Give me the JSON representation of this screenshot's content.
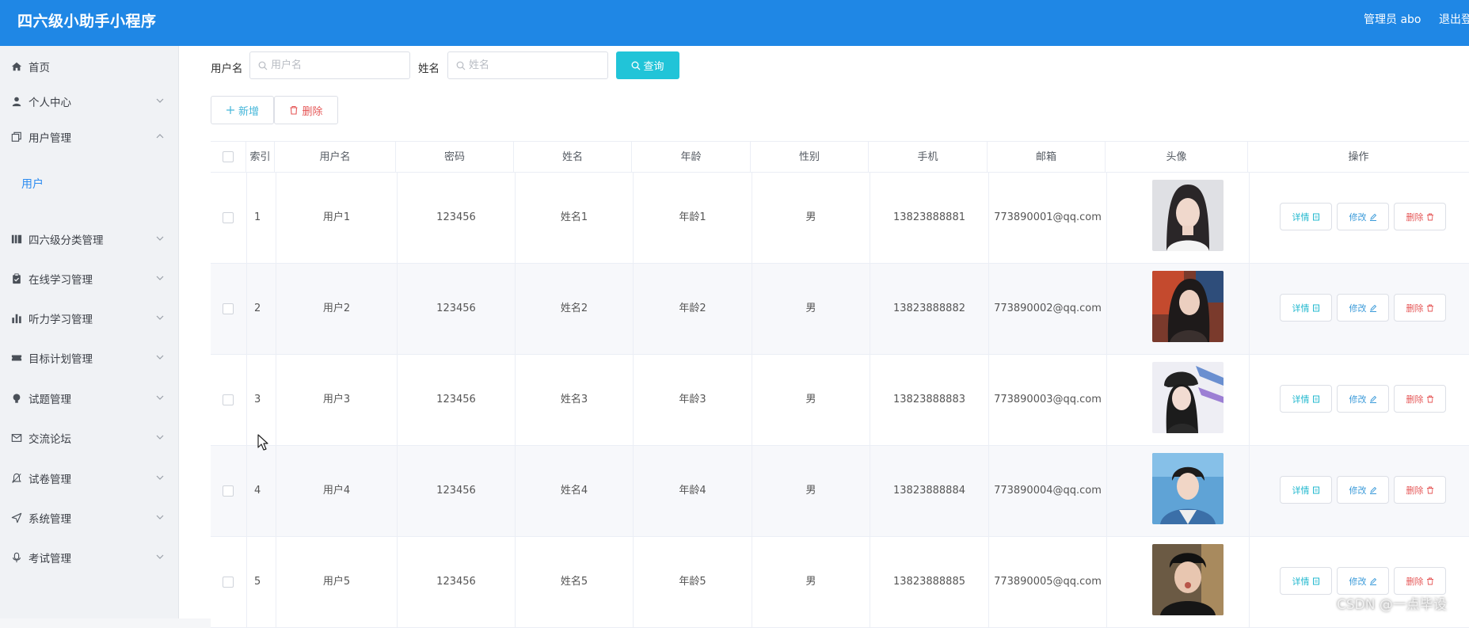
{
  "header": {
    "title": "四六级小助手小程序",
    "admin": "管理员 abo",
    "logout": "退出登"
  },
  "sidebar": {
    "items": [
      {
        "label": "首页",
        "icon": "home-icon"
      },
      {
        "label": "个人中心",
        "icon": "user-icon"
      },
      {
        "label": "用户管理",
        "icon": "copy-icon"
      },
      {
        "label": "四六级分类管理",
        "icon": "category-icon"
      },
      {
        "label": "在线学习管理",
        "icon": "clipboard-icon"
      },
      {
        "label": "听力学习管理",
        "icon": "bar-chart-icon"
      },
      {
        "label": "目标计划管理",
        "icon": "ticket-icon"
      },
      {
        "label": "试题管理",
        "icon": "bulb-icon"
      },
      {
        "label": "交流论坛",
        "icon": "message-icon"
      },
      {
        "label": "试卷管理",
        "icon": "bell-icon"
      },
      {
        "label": "系统管理",
        "icon": "send-icon"
      },
      {
        "label": "考试管理",
        "icon": "mic-icon"
      }
    ],
    "submenu": "用户"
  },
  "search": {
    "username_label": "用户名",
    "username_placeholder": "用户名",
    "name_label": "姓名",
    "name_placeholder": "姓名",
    "query_button": "查询"
  },
  "toolbar": {
    "add_button": "新增",
    "delete_button": "删除"
  },
  "table": {
    "columns": [
      "索引",
      "用户名",
      "密码",
      "姓名",
      "年龄",
      "性别",
      "手机",
      "邮箱",
      "头像",
      "操作"
    ],
    "actions": {
      "detail": "详情",
      "edit": "修改",
      "delete": "删除"
    },
    "rows": [
      {
        "index": "1",
        "username": "用户1",
        "password": "123456",
        "name": "姓名1",
        "age": "年龄1",
        "gender": "男",
        "phone": "13823888881",
        "email": "773890001@qq.com"
      },
      {
        "index": "2",
        "username": "用户2",
        "password": "123456",
        "name": "姓名2",
        "age": "年龄2",
        "gender": "男",
        "phone": "13823888882",
        "email": "773890002@qq.com"
      },
      {
        "index": "3",
        "username": "用户3",
        "password": "123456",
        "name": "姓名3",
        "age": "年龄3",
        "gender": "男",
        "phone": "13823888883",
        "email": "773890003@qq.com"
      },
      {
        "index": "4",
        "username": "用户4",
        "password": "123456",
        "name": "姓名4",
        "age": "年龄4",
        "gender": "男",
        "phone": "13823888884",
        "email": "773890004@qq.com"
      },
      {
        "index": "5",
        "username": "用户5",
        "password": "123456",
        "name": "姓名5",
        "age": "年龄5",
        "gender": "男",
        "phone": "13823888885",
        "email": "773890005@qq.com"
      }
    ]
  },
  "watermark": "CSDN @一点毕设",
  "colors": {
    "header": "#1f87e5",
    "query_button": "#21c4d8",
    "active_submenu": "#2d8cf0",
    "danger": "#e55656"
  }
}
